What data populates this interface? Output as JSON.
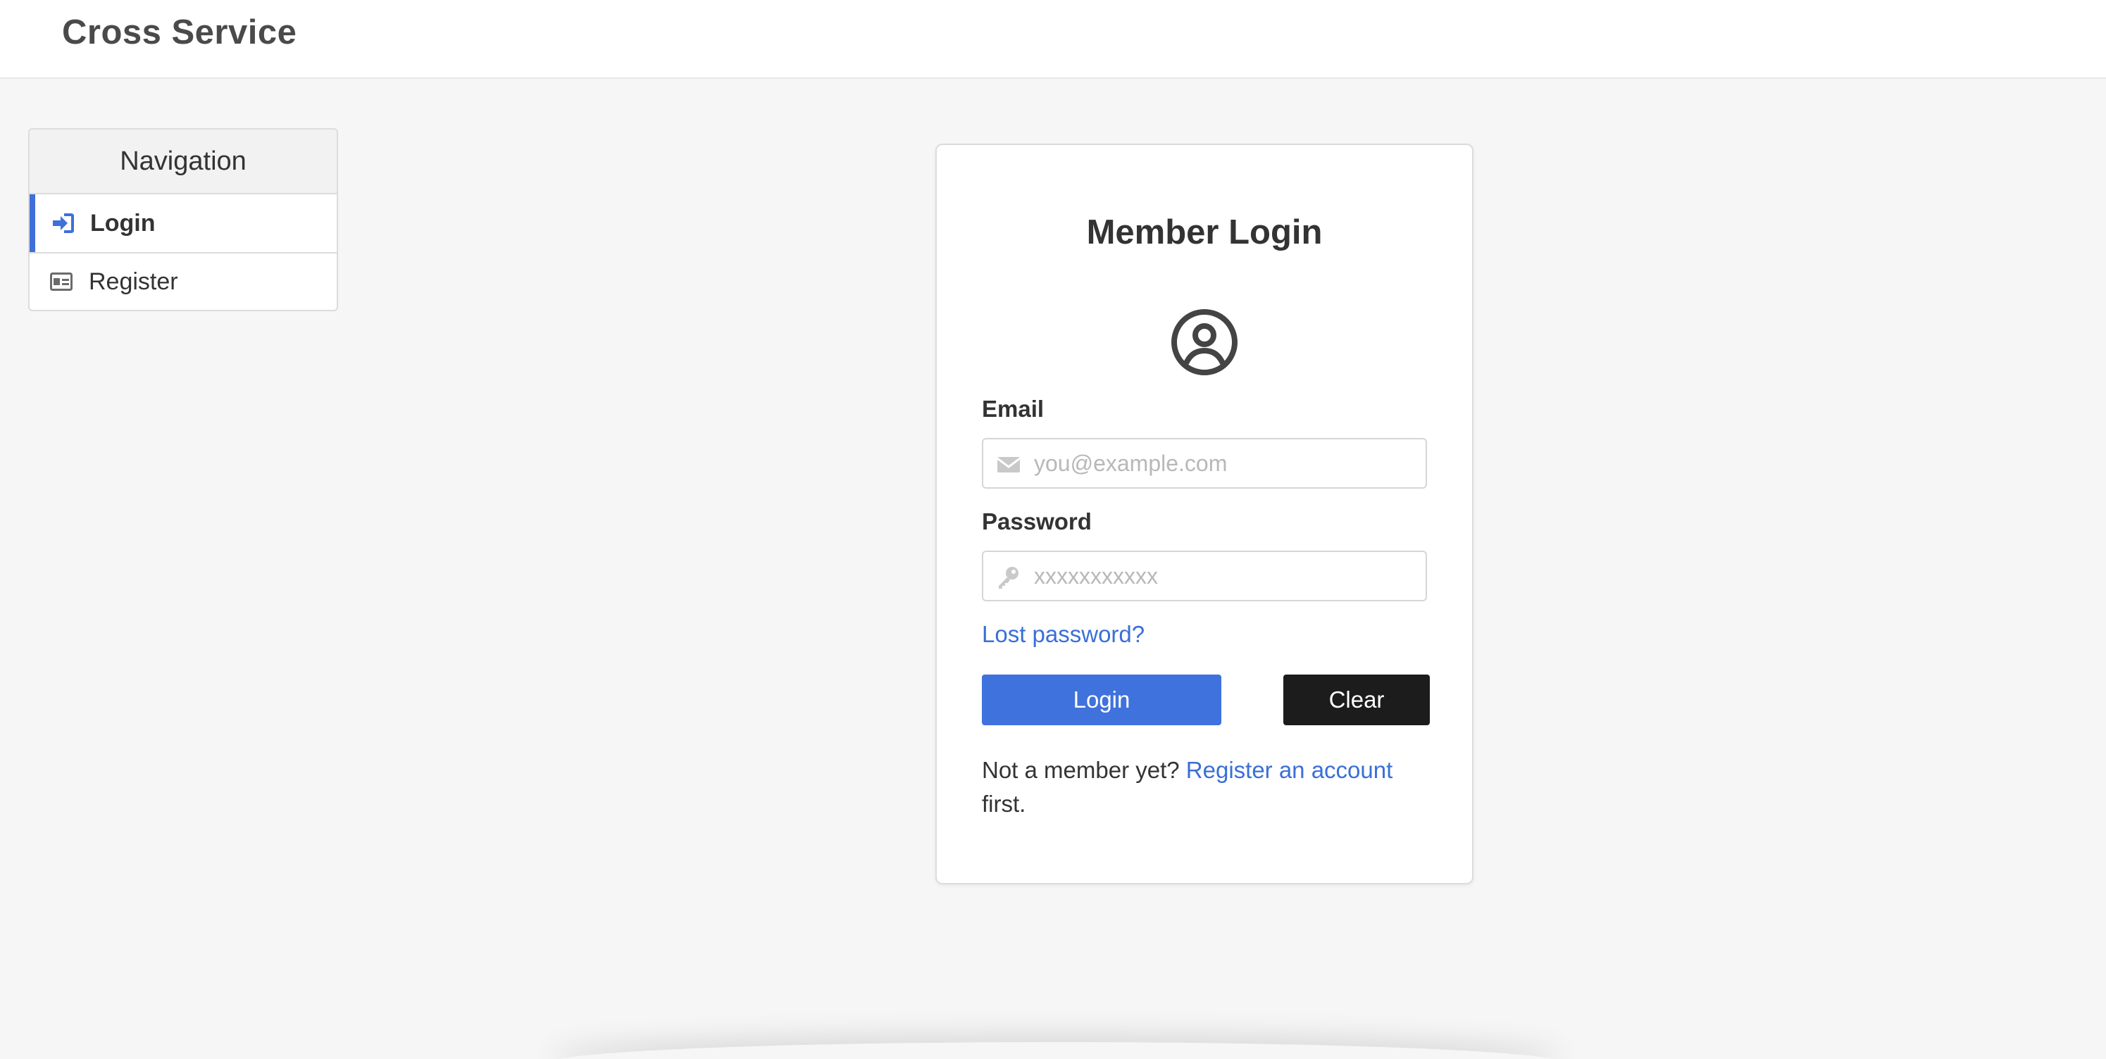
{
  "header": {
    "brand": "Cross Service"
  },
  "nav": {
    "title": "Navigation",
    "items": [
      {
        "label": "Login",
        "icon": "sign-in-icon",
        "active": true
      },
      {
        "label": "Register",
        "icon": "id-card-icon",
        "active": false
      }
    ]
  },
  "login": {
    "title": "Member Login",
    "avatar_icon": "user-circle-icon",
    "email": {
      "label": "Email",
      "placeholder": "you@example.com",
      "value": ""
    },
    "password": {
      "label": "Password",
      "placeholder": "xxxxxxxxxxx",
      "value": ""
    },
    "lost_password": "Lost password?",
    "login_button": "Login",
    "clear_button": "Clear",
    "footer": {
      "prefix": "Not a member yet? ",
      "link": "Register an account",
      "suffix": " first."
    }
  },
  "colors": {
    "accent": "#3f72dc",
    "link": "#3a6fd6",
    "dark_button": "#1c1c1c",
    "background": "#f6f6f6"
  }
}
